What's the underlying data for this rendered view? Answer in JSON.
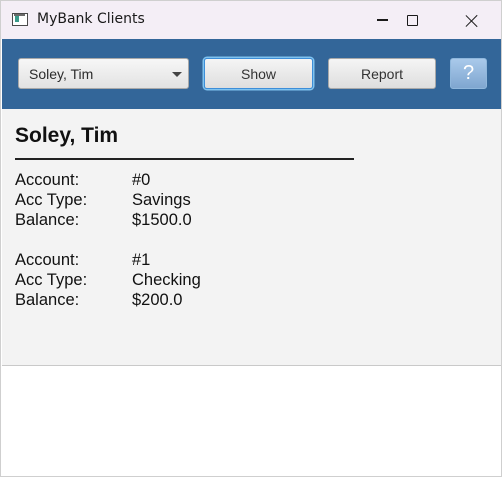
{
  "window": {
    "title": "MyBank Clients",
    "icon": "app-window-icon"
  },
  "toolbar": {
    "client_select": {
      "selected": "Soley, Tim"
    },
    "show_label": "Show",
    "report_label": "Report",
    "help_label": "?"
  },
  "colors": {
    "toolbar_bg": "#336699",
    "content_bg": "#f3f3f3",
    "focus_ring": "#3d8ed8"
  },
  "client": {
    "name": "Soley, Tim",
    "accounts": [
      {
        "account_label": "Account:",
        "account": "#0",
        "type_label": "Acc Type:",
        "type": "Savings",
        "balance_label": "Balance:",
        "balance": "$1500.0"
      },
      {
        "account_label": "Account:",
        "account": "#1",
        "type_label": "Acc Type:",
        "type": "Checking",
        "balance_label": "Balance:",
        "balance": "$200.0"
      }
    ]
  }
}
